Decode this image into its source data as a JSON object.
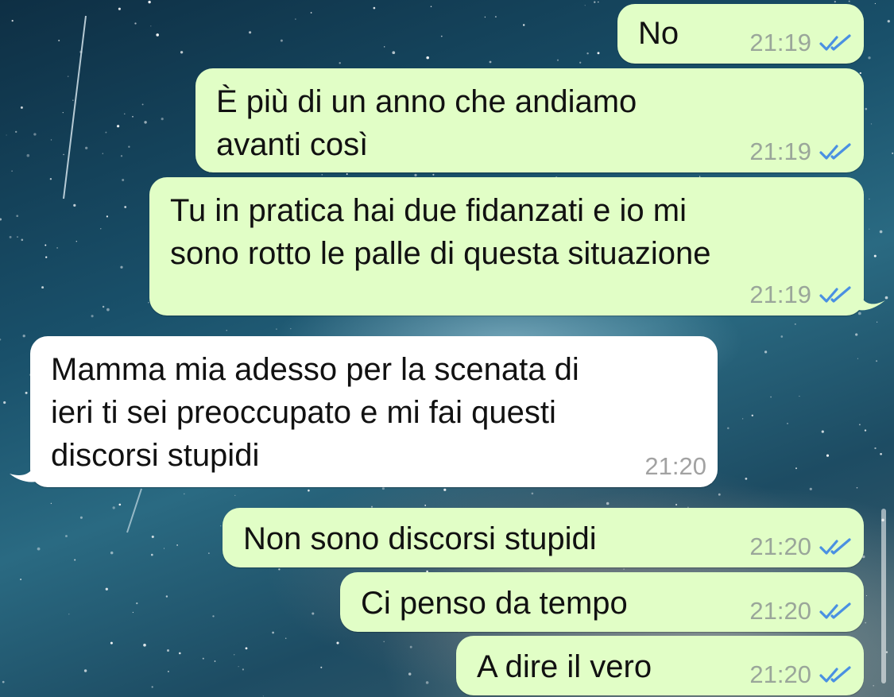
{
  "messages": [
    {
      "direction": "outgoing",
      "lines": [
        "No"
      ],
      "time": "21:19",
      "status": "read"
    },
    {
      "direction": "outgoing",
      "lines": [
        "È più di un anno che andiamo",
        "avanti così"
      ],
      "time": "21:19",
      "status": "read"
    },
    {
      "direction": "outgoing",
      "lines": [
        "Tu in pratica hai due fidanzati e io mi",
        "sono rotto le palle di questa situazione"
      ],
      "time": "21:19",
      "status": "read"
    },
    {
      "direction": "incoming",
      "lines": [
        "Mamma mia adesso per la scenata di",
        "ieri ti sei preoccupato e mi fai questi",
        "discorsi stupidi"
      ],
      "time": "21:20"
    },
    {
      "direction": "outgoing",
      "lines": [
        "Non sono discorsi stupidi"
      ],
      "time": "21:20",
      "status": "read"
    },
    {
      "direction": "outgoing",
      "lines": [
        "Ci penso da tempo"
      ],
      "time": "21:20",
      "status": "read"
    },
    {
      "direction": "outgoing",
      "lines": [
        "A dire il vero"
      ],
      "time": "21:20",
      "status": "read"
    }
  ],
  "colors": {
    "outgoing_bubble": "#e1fec6",
    "incoming_bubble": "#ffffff",
    "read_ticks": "#4a90e2",
    "timestamp": "#9aa69a"
  },
  "icons": {
    "read_receipt": "double-check-icon"
  }
}
